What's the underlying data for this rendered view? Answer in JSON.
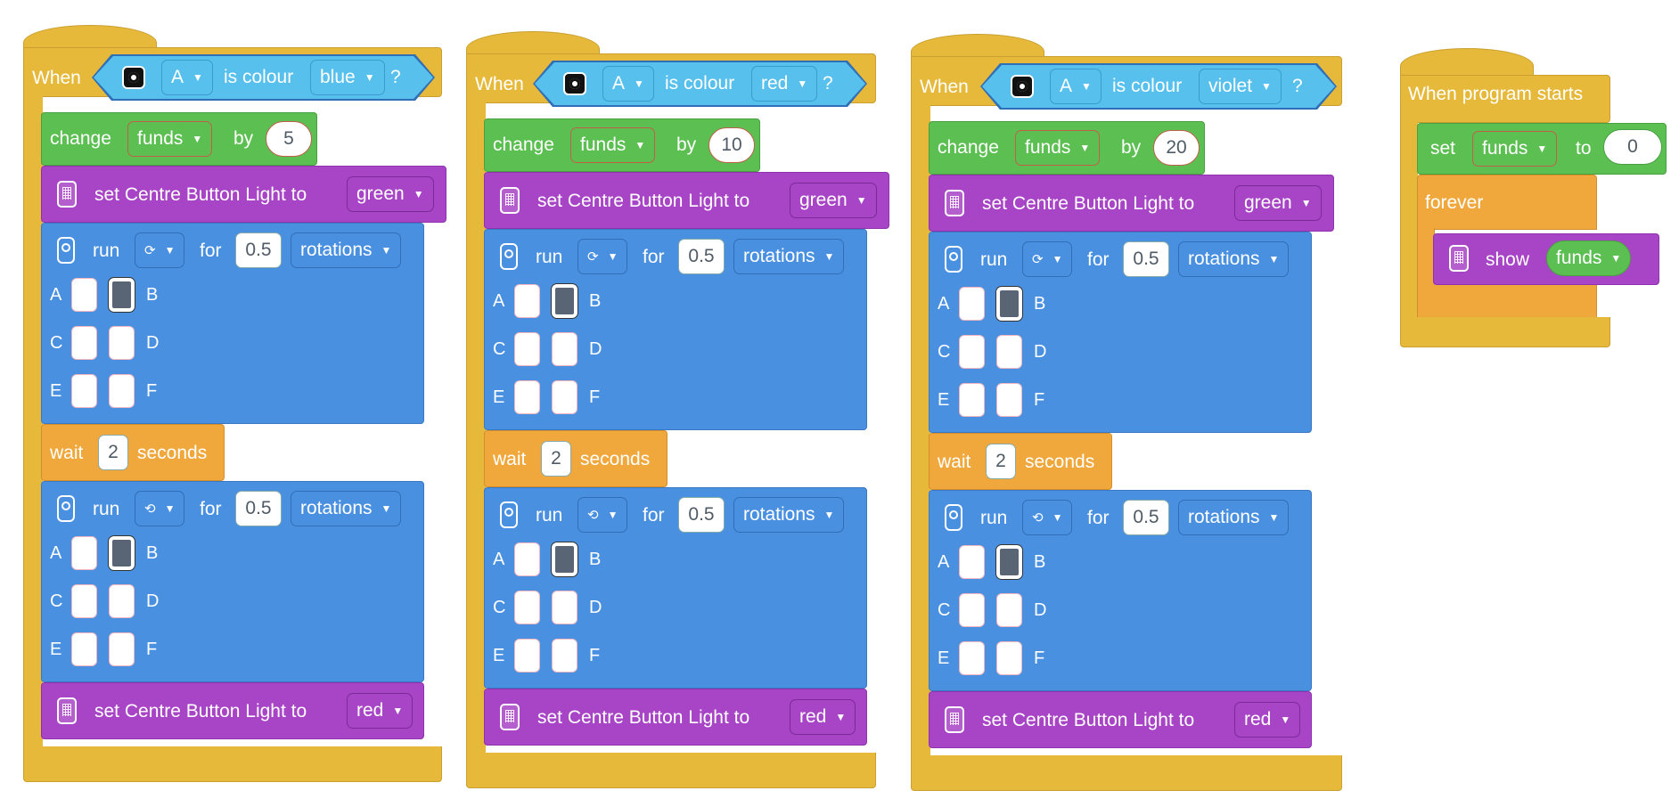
{
  "stacks": [
    {
      "when": "When",
      "sensor_port": "A",
      "is_colour": "is colour",
      "colour": "blue",
      "question": "?",
      "change": {
        "label": "change",
        "var": "funds",
        "by": "by",
        "amount": "5"
      },
      "set1": {
        "label": "set Centre Button Light to",
        "value": "green"
      },
      "run1": {
        "run": "run",
        "dir_icon": "clockwise-icon",
        "for": "for",
        "amount": "0.5",
        "unit": "rotations",
        "ports": {
          "a": "A",
          "b": "B",
          "c": "C",
          "d": "D",
          "e": "E",
          "f": "F"
        }
      },
      "wait": {
        "label": "wait",
        "amount": "2",
        "unit": "seconds"
      },
      "run2": {
        "run": "run",
        "dir_icon": "counterclockwise-icon",
        "for": "for",
        "amount": "0.5",
        "unit": "rotations",
        "ports": {
          "a": "A",
          "b": "B",
          "c": "C",
          "d": "D",
          "e": "E",
          "f": "F"
        }
      },
      "set2": {
        "label": "set Centre Button Light to",
        "value": "red"
      }
    },
    {
      "when": "When",
      "sensor_port": "A",
      "is_colour": "is colour",
      "colour": "red",
      "question": "?",
      "change": {
        "label": "change",
        "var": "funds",
        "by": "by",
        "amount": "10"
      },
      "set1": {
        "label": "set Centre Button Light to",
        "value": "green"
      },
      "run1": {
        "run": "run",
        "dir_icon": "clockwise-icon",
        "for": "for",
        "amount": "0.5",
        "unit": "rotations",
        "ports": {
          "a": "A",
          "b": "B",
          "c": "C",
          "d": "D",
          "e": "E",
          "f": "F"
        }
      },
      "wait": {
        "label": "wait",
        "amount": "2",
        "unit": "seconds"
      },
      "run2": {
        "run": "run",
        "dir_icon": "counterclockwise-icon",
        "for": "for",
        "amount": "0.5",
        "unit": "rotations",
        "ports": {
          "a": "A",
          "b": "B",
          "c": "C",
          "d": "D",
          "e": "E",
          "f": "F"
        }
      },
      "set2": {
        "label": "set Centre Button Light to",
        "value": "red"
      }
    },
    {
      "when": "When",
      "sensor_port": "A",
      "is_colour": "is colour",
      "colour": "violet",
      "question": "?",
      "change": {
        "label": "change",
        "var": "funds",
        "by": "by",
        "amount": "20"
      },
      "set1": {
        "label": "set Centre Button Light to",
        "value": "green"
      },
      "run1": {
        "run": "run",
        "dir_icon": "clockwise-icon",
        "for": "for",
        "amount": "0.5",
        "unit": "rotations",
        "ports": {
          "a": "A",
          "b": "B",
          "c": "C",
          "d": "D",
          "e": "E",
          "f": "F"
        }
      },
      "wait": {
        "label": "wait",
        "amount": "2",
        "unit": "seconds"
      },
      "run2": {
        "run": "run",
        "dir_icon": "counterclockwise-icon",
        "for": "for",
        "amount": "0.5",
        "unit": "rotations",
        "ports": {
          "a": "A",
          "b": "B",
          "c": "C",
          "d": "D",
          "e": "E",
          "f": "F"
        }
      },
      "set2": {
        "label": "set Centre Button Light to",
        "value": "red"
      }
    }
  ],
  "program": {
    "when": "When program starts",
    "set": {
      "label": "set",
      "var": "funds",
      "to": "to",
      "value": "0"
    },
    "forever": "forever",
    "show": {
      "label": "show",
      "var": "funds"
    }
  },
  "colors": {
    "events": "#e6b93a",
    "variables": "#5cbf52",
    "light": "#a844c6",
    "motors": "#4a90e0",
    "control": "#f0a83c",
    "sensor": "#58c0ec"
  }
}
